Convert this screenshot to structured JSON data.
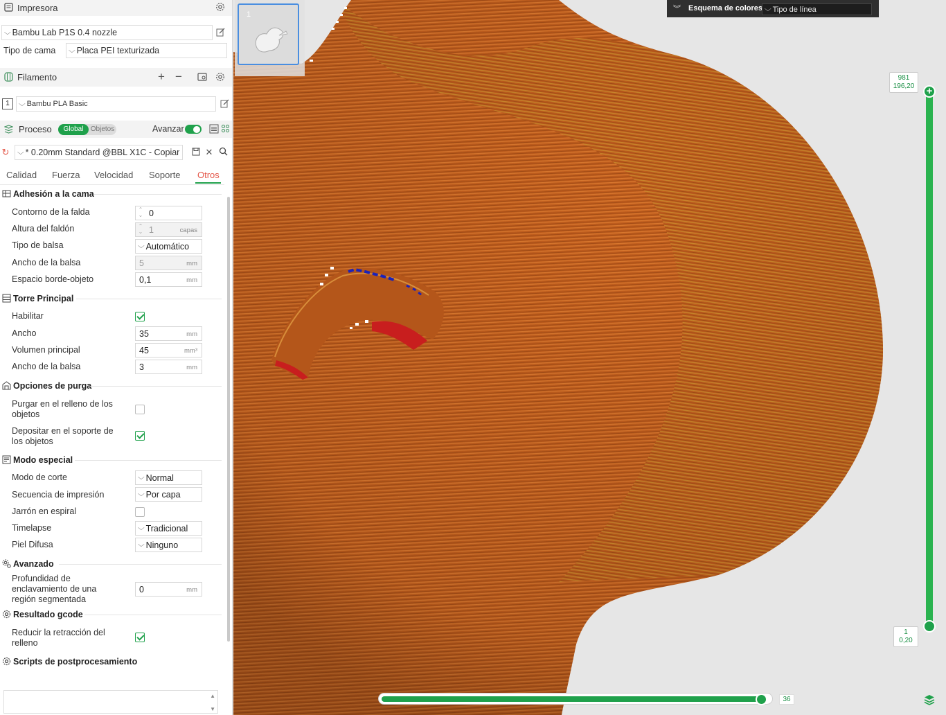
{
  "printer": {
    "title": "Impresora",
    "model": "Bambu Lab P1S 0.4 nozzle",
    "bed_label": "Tipo de cama",
    "bed_value": "Placa PEI texturizada"
  },
  "filament": {
    "title": "Filamento",
    "slot": "1",
    "name": "Bambu PLA Basic"
  },
  "process": {
    "title": "Proceso",
    "toggle_global": "Global",
    "toggle_objects": "Objetos",
    "advanced_label": "Avanzar",
    "preset": "* 0.20mm Standard @BBL X1C - Copiar"
  },
  "tabs": [
    "Calidad",
    "Fuerza",
    "Velocidad",
    "Soporte",
    "Otros"
  ],
  "groups": {
    "bed_adhesion": {
      "title": "Adhesión a la cama",
      "skirt_loops": {
        "label": "Contorno de la falda",
        "value": "0"
      },
      "skirt_height": {
        "label": "Altura del faldón",
        "value": "1",
        "unit": "capas"
      },
      "brim_type": {
        "label": "Tipo de balsa",
        "value": "Automático"
      },
      "brim_width": {
        "label": "Ancho de la balsa",
        "value": "5",
        "unit": "mm"
      },
      "brim_gap": {
        "label": "Espacio borde-objeto",
        "value": "0,1",
        "unit": "mm"
      }
    },
    "prime_tower": {
      "title": "Torre Principal",
      "enable": {
        "label": "Habilitar",
        "checked": true
      },
      "width": {
        "label": "Ancho",
        "value": "35",
        "unit": "mm"
      },
      "volume": {
        "label": "Volumen principal",
        "value": "45",
        "unit": "mm³"
      },
      "brim": {
        "label": "Ancho de la balsa",
        "value": "3",
        "unit": "mm"
      }
    },
    "purge": {
      "title": "Opciones de purga",
      "infill": {
        "label": "Purgar en el relleno de los objetos",
        "checked": false
      },
      "support": {
        "label": "Depositar en el soporte de los objetos",
        "checked": true
      }
    },
    "special": {
      "title": "Modo especial",
      "slicing_mode": {
        "label": "Modo de corte",
        "value": "Normal"
      },
      "print_sequence": {
        "label": "Secuencia de impresión",
        "value": "Por capa"
      },
      "spiral": {
        "label": "Jarrón en espiral",
        "checked": false
      },
      "timelapse": {
        "label": "Timelapse",
        "value": "Tradicional"
      },
      "fuzzy": {
        "label": "Piel Difusa",
        "value": "Ninguno"
      }
    },
    "advanced": {
      "title": "Avanzado",
      "interlock": {
        "label": "Profundidad de enclavamiento de una región segmentada",
        "value": "0",
        "unit": "mm"
      }
    },
    "gcode": {
      "title": "Resultado gcode",
      "reduce_retract": {
        "label": "Reducir la retracción del relleno",
        "checked": true
      }
    },
    "post": {
      "title": "Scripts de postprocesamiento"
    }
  },
  "viewport": {
    "plate_number": "1",
    "legend_title": "Esquema de colores",
    "legend_value": "Tipo de línea",
    "layer_top": "981",
    "layer_top_height": "196,20",
    "layer_bottom": "1",
    "layer_bottom_height": "0,20",
    "move_value": "36",
    "move_progress": 0.98
  },
  "colors": {
    "accent": "#1fa14b",
    "active_tab": "#e4584a",
    "model_orange": "#c35e1e",
    "overhang_red": "#c81e1e",
    "bridge_blue": "#1c22b8"
  }
}
